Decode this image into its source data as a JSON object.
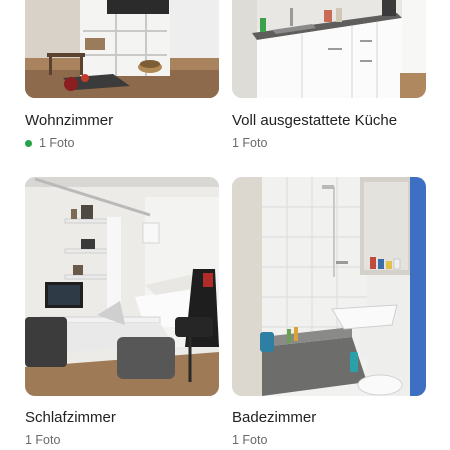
{
  "rooms": [
    {
      "title": "Wohnzimmer",
      "photos": "1 Foto",
      "status_dot": true,
      "status_color": "#26a249",
      "image": "living-room-photo"
    },
    {
      "title": "Voll ausgestattete Küche",
      "photos": "1 Foto",
      "status_dot": false,
      "image": "kitchen-photo"
    },
    {
      "title": "Schlafzimmer",
      "photos": "1 Foto",
      "status_dot": false,
      "image": "bedroom-photo"
    },
    {
      "title": "Badezimmer",
      "photos": "1 Foto",
      "status_dot": false,
      "image": "bathroom-photo"
    }
  ]
}
